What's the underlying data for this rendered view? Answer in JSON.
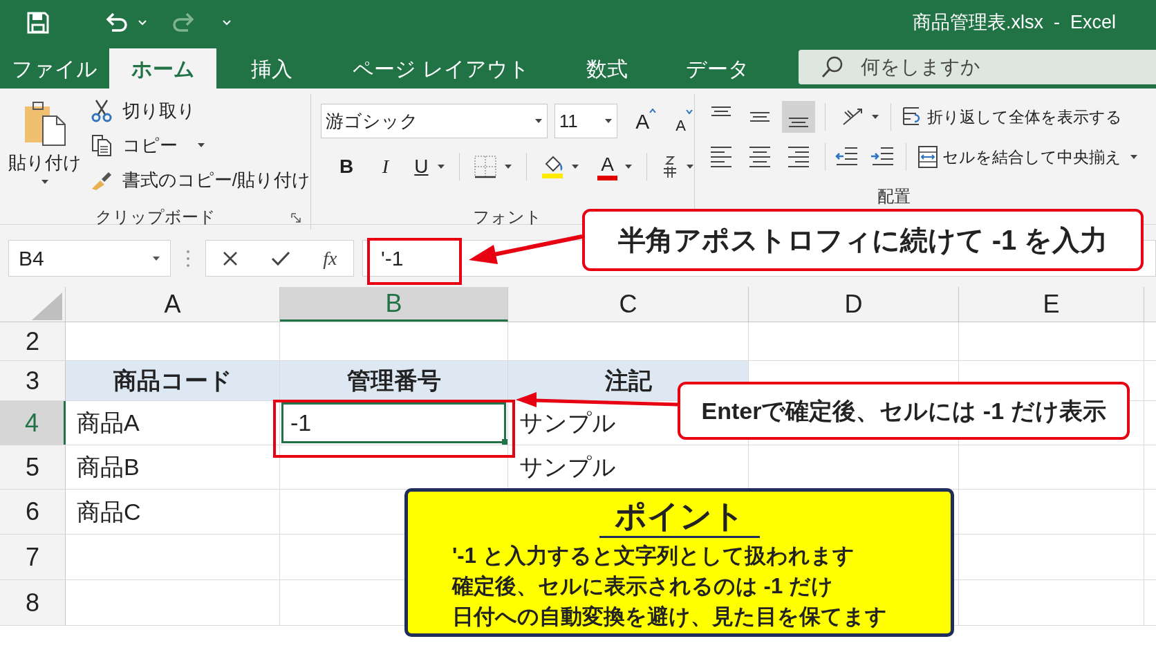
{
  "window": {
    "title": "商品管理表.xlsx  -  Excel"
  },
  "tabs": [
    {
      "label": "ファイル",
      "selected": false
    },
    {
      "label": "ホーム",
      "selected": true
    },
    {
      "label": "挿入",
      "selected": false
    },
    {
      "label": "ページ レイアウト",
      "selected": false
    },
    {
      "label": "数式",
      "selected": false
    },
    {
      "label": "データ",
      "selected": false
    }
  ],
  "search": {
    "placeholder": "何をしますか"
  },
  "ribbon": {
    "clipboard": {
      "paste": "貼り付け",
      "label": "クリップボード",
      "items": [
        {
          "kind": "cut",
          "label": "切り取り"
        },
        {
          "kind": "copy",
          "label": "コピー"
        },
        {
          "kind": "format_painter",
          "label": "書式のコピー/貼り付け"
        }
      ]
    },
    "font": {
      "font_name": "游ゴシック",
      "font_size": "11",
      "grow": "A",
      "shrink": "A",
      "bold": "B",
      "italic": "I",
      "underline": "U",
      "font_color": "A",
      "label": "フォント"
    },
    "alignment": {
      "vertical": [
        {
          "kind": "top",
          "selected": false
        },
        {
          "kind": "middle",
          "selected": false
        },
        {
          "kind": "bottom",
          "selected": true
        }
      ],
      "wrap": "折り返して全体を表示する",
      "merge": "セルを結合して中央揃え",
      "label": "配置"
    }
  },
  "formula_bar": {
    "name_box": "B4",
    "function": "fx",
    "value": "'-1"
  },
  "sheet": {
    "columns": [
      {
        "label": "A",
        "selected": false
      },
      {
        "label": "B",
        "selected": true
      },
      {
        "label": "C",
        "selected": false
      },
      {
        "label": "D",
        "selected": false
      },
      {
        "label": "E",
        "selected": false
      }
    ],
    "rows": [
      {
        "number": "2",
        "kind": "data",
        "selected": false,
        "cells": {}
      },
      {
        "number": "3",
        "kind": "header",
        "selected": false,
        "cells": {
          "A": "商品コード",
          "B": "管理番号",
          "C": "注記"
        }
      },
      {
        "number": "4",
        "kind": "data",
        "selected": true,
        "cells": {
          "A": "商品A",
          "B": "-1",
          "C": "サンプル"
        }
      },
      {
        "number": "5",
        "kind": "data",
        "selected": false,
        "cells": {
          "A": "商品B",
          "C": "サンプル"
        }
      },
      {
        "number": "6",
        "kind": "data",
        "selected": false,
        "cells": {
          "A": "商品C"
        }
      },
      {
        "number": "7",
        "kind": "data",
        "selected": false,
        "cells": {}
      },
      {
        "number": "8",
        "kind": "data",
        "selected": false,
        "cells": {}
      }
    ]
  },
  "annotations": {
    "formula_callout": "半角アポストロフィに続けて -1 を入力",
    "cell_callout": "Enterで確定後、セルには -1 だけ表示",
    "point": {
      "title": "ポイント",
      "lines": [
        "'-1 と入力すると文字列として扱われます",
        "確定後、セルに表示されるのは -1 だけ",
        "日付への自動変換を避け、見た目を保てます"
      ]
    }
  }
}
